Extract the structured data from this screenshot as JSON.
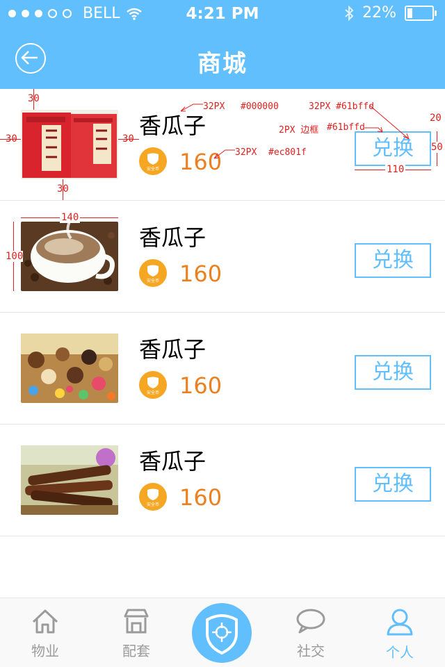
{
  "status_bar": {
    "carrier": "BELL",
    "time": "4:21 PM",
    "battery": "22%"
  },
  "header": {
    "title": "商城"
  },
  "items": [
    {
      "name": "香瓜子",
      "price": "160",
      "button": "兑换"
    },
    {
      "name": "香瓜子",
      "price": "160",
      "button": "兑换"
    },
    {
      "name": "香瓜子",
      "price": "160",
      "button": "兑换"
    },
    {
      "name": "香瓜子",
      "price": "160",
      "button": "兑换"
    }
  ],
  "coin_label": "安全币",
  "annotations": {
    "top_margin": "30",
    "left_margin": "30",
    "right_gap": "30",
    "bottom_margin": "30",
    "thumb_width": "140",
    "thumb_height": "100",
    "name_spec": "32PX",
    "name_color": "#000000",
    "price_spec": "32PX",
    "price_color": "#ec801f",
    "button_spec": "32PX #61bffd",
    "border_spec": "2PX 边框",
    "border_color": "#61bffd",
    "button_width": "110",
    "button_height": "50",
    "right_margin": "20"
  },
  "tabbar": {
    "tabs": [
      {
        "label": "物业",
        "icon": "house-icon"
      },
      {
        "label": "配套",
        "icon": "store-icon"
      },
      {
        "label": "社交",
        "icon": "chat-bubble-icon"
      },
      {
        "label": "个人",
        "icon": "person-icon"
      }
    ],
    "center_icon": "shield-target-icon"
  },
  "colors": {
    "primary": "#61bffd",
    "price": "#ec801f",
    "coin": "#f5a623"
  }
}
